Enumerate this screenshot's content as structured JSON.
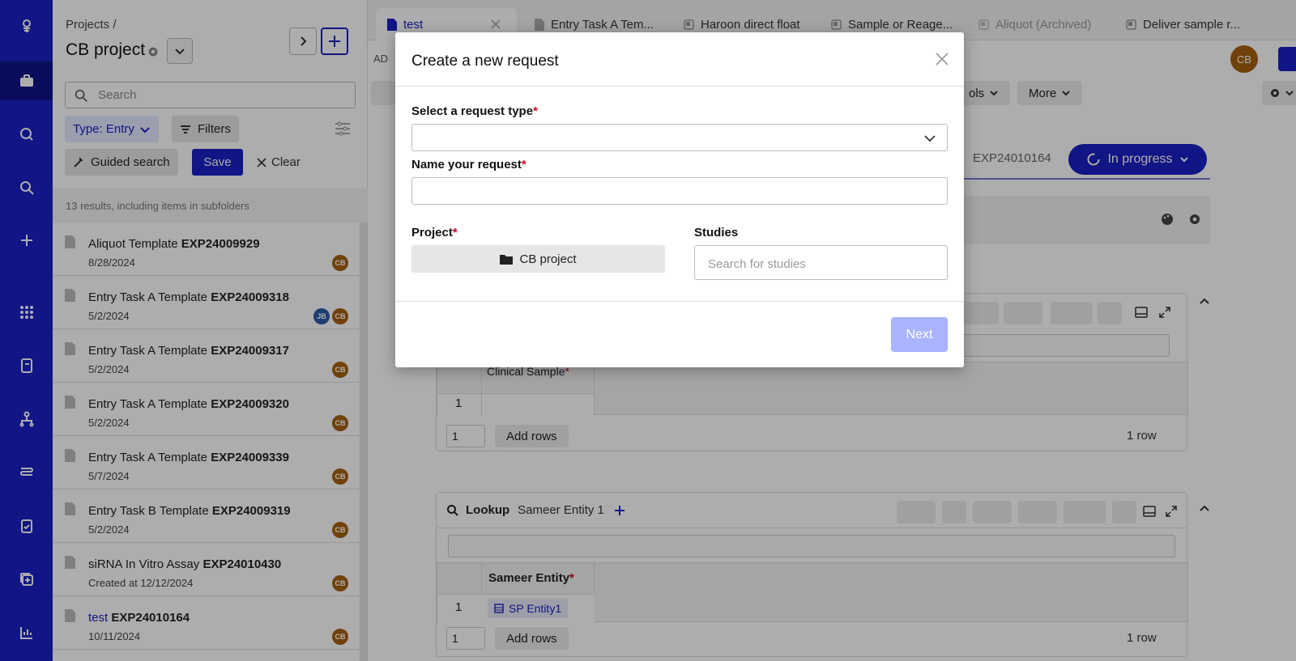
{
  "colors": {
    "brand": "#1a20c4",
    "avatar": "#a6600f",
    "avatar_alt": "#2b5ca8",
    "required": "#d0021b",
    "next_disabled": "#a9b3ff"
  },
  "rail": {
    "icons": [
      "logo-icon",
      "briefcase-icon",
      "insights-icon",
      "search-icon",
      "plus-icon",
      "apps-icon",
      "notebook-icon",
      "hierarchy-icon",
      "workflow-icon",
      "clipboard-icon",
      "copy-add-icon",
      "chart-icon"
    ]
  },
  "panel": {
    "breadcrumb": "Projects /",
    "title": "CB project",
    "search_placeholder": "Search",
    "type_filter": "Type: Entry",
    "filters_label": "Filters",
    "guided_search_label": "Guided search",
    "save_label": "Save",
    "clear_label": "Clear",
    "results_text": "13 results, including items in subfolders",
    "items": [
      {
        "name": "Aliquot Template",
        "id": "EXP24009929",
        "date": "8/28/2024",
        "avatars": [
          "CB"
        ]
      },
      {
        "name": "Entry Task A Template",
        "id": "EXP24009318",
        "date": "5/2/2024",
        "avatars": [
          "JB",
          "CB"
        ]
      },
      {
        "name": "Entry Task A Template",
        "id": "EXP24009317",
        "date": "5/2/2024",
        "avatars": [
          "CB"
        ]
      },
      {
        "name": "Entry Task A Template",
        "id": "EXP24009320",
        "date": "5/2/2024",
        "avatars": [
          "CB"
        ]
      },
      {
        "name": "Entry Task A Template",
        "id": "EXP24009339",
        "date": "5/7/2024",
        "avatars": [
          "CB"
        ]
      },
      {
        "name": "Entry Task B Template",
        "id": "EXP24009319",
        "date": "5/2/2024",
        "avatars": [
          "CB"
        ]
      },
      {
        "name": "siRNA In Vitro Assay",
        "id": "EXP24010430",
        "date": "Created at 12/12/2024",
        "avatars": [
          "CB"
        ]
      },
      {
        "name": "test",
        "id": "EXP24010164",
        "date": "10/11/2024",
        "avatars": [
          "CB"
        ]
      }
    ]
  },
  "tabs": [
    {
      "label": "test"
    },
    {
      "label": "Entry Task A Tem..."
    },
    {
      "label": "Haroon direct float"
    },
    {
      "label": "Sample or Reage..."
    },
    {
      "label": "Aliquot",
      "suffix": "(Archived)"
    },
    {
      "label": "Deliver sample r..."
    }
  ],
  "doc": {
    "partial_tab_text": "AD",
    "tools_label": "ols",
    "more_label": "More",
    "user_initials": "CB",
    "exp_id": "EXP24010164",
    "status": "In progress",
    "section1": {
      "col_header": "Clinical Sample",
      "row_num": "1",
      "rows_input": "1",
      "add_rows": "Add rows",
      "row_count": "1 row"
    },
    "section2": {
      "title": "Lookup",
      "subtitle": "Sameer Entity 1",
      "col_header": "Sameer Entity",
      "row_num": "1",
      "cell_value": "SP Entity1",
      "rows_input": "1",
      "add_rows": "Add rows",
      "row_count": "1 row"
    }
  },
  "modal": {
    "title": "Create a new request",
    "request_type_label": "Select a request type",
    "request_type_value": "",
    "name_label": "Name your request",
    "name_value": "",
    "project_label": "Project",
    "project_value": "CB project",
    "studies_label": "Studies",
    "studies_placeholder": "Search for studies",
    "required_mark": "*",
    "next_label": "Next"
  }
}
